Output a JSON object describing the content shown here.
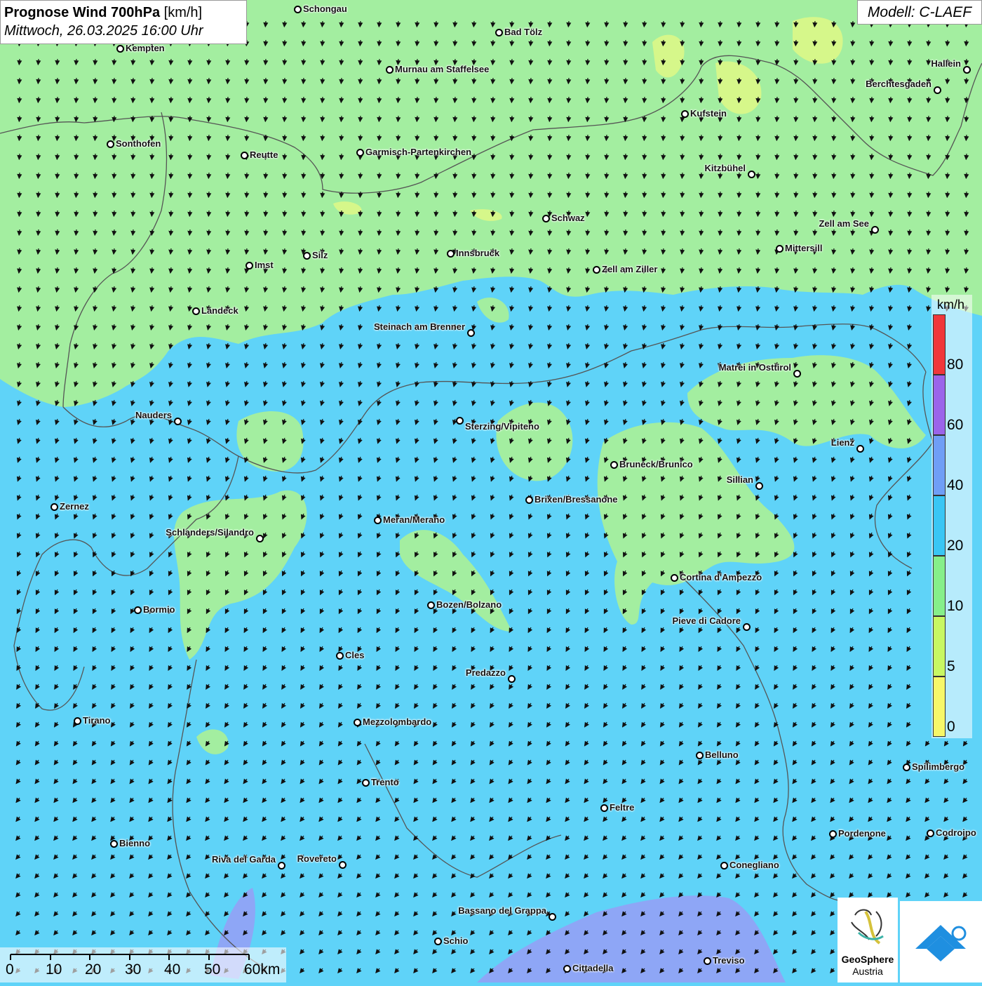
{
  "title": {
    "main": "Prognose Wind 700hPa",
    "unit": "[km/h]",
    "datetime": "Mittwoch, 26.03.2025 16:00 Uhr"
  },
  "model": "Modell: C-LAEF",
  "colors": {
    "green_zone": "#a3eea0",
    "blue_zone": "#5fd3f8",
    "violet_zone": "#8ea6f6",
    "yellow_zone": "#e6f98a",
    "arrow": "#111111",
    "border": "#555555"
  },
  "legend": {
    "unit": "km/h",
    "labels": [
      "80",
      "60",
      "40",
      "20",
      "10",
      "5",
      "0"
    ],
    "stops": [
      {
        "from": 80,
        "color": "#f0373a"
      },
      {
        "from": 60,
        "color": "#9b64ea"
      },
      {
        "from": 40,
        "color": "#6f9ef6"
      },
      {
        "from": 20,
        "color": "#39c6f4"
      },
      {
        "from": 10,
        "color": "#86ef8a"
      },
      {
        "from": 5,
        "color": "#c8f762"
      },
      {
        "from": 0,
        "color": "#f7f769"
      }
    ]
  },
  "scalebar": {
    "labels": [
      "0",
      "10",
      "20",
      "30",
      "40",
      "50",
      "60km"
    ]
  },
  "cities": [
    {
      "name": "Schongau",
      "label_side": "right"
    },
    {
      "name": "Bad Tölz",
      "label_side": "right"
    },
    {
      "name": "Kempten",
      "label_side": "right"
    },
    {
      "name": "Hallein",
      "label_side": "left"
    },
    {
      "name": "Murnau am Staffelsee",
      "label_side": "right"
    },
    {
      "name": "Berchtesgaden",
      "label_side": "left"
    },
    {
      "name": "Kufstein",
      "label_side": "right"
    },
    {
      "name": "Sonthofen",
      "label_side": "right"
    },
    {
      "name": "Reutte",
      "label_side": "right"
    },
    {
      "name": "Garmisch-Partenkirchen",
      "label_side": "right"
    },
    {
      "name": "Kitzbühel",
      "label_side": "left"
    },
    {
      "name": "Schwaz",
      "label_side": "right"
    },
    {
      "name": "Zell am See",
      "label_side": "left"
    },
    {
      "name": "Mittersill",
      "label_side": "right"
    },
    {
      "name": "Innsbruck",
      "label_side": "right"
    },
    {
      "name": "Silz",
      "label_side": "right"
    },
    {
      "name": "Imst",
      "label_side": "right"
    },
    {
      "name": "Zell am Ziller",
      "label_side": "right"
    },
    {
      "name": "Landeck",
      "label_side": "right"
    },
    {
      "name": "Steinach am Brenner",
      "label_side": "left"
    },
    {
      "name": "Matrei in Osttirol",
      "label_side": "left"
    },
    {
      "name": "Nauders",
      "label_side": "left"
    },
    {
      "name": "Sterzing/Vipiteno",
      "label_side": "below"
    },
    {
      "name": "Lienz",
      "label_side": "left"
    },
    {
      "name": "Bruneck/Brunico",
      "label_side": "right"
    },
    {
      "name": "Sillian",
      "label_side": "left"
    },
    {
      "name": "Brixen/Bressanone",
      "label_side": "right"
    },
    {
      "name": "Zernez",
      "label_side": "right"
    },
    {
      "name": "Meran/Merano",
      "label_side": "right"
    },
    {
      "name": "Schlanders/Silandro",
      "label_side": "left"
    },
    {
      "name": "Cortina d'Ampezzo",
      "label_side": "right"
    },
    {
      "name": "Bozen/Bolzano",
      "label_side": "right"
    },
    {
      "name": "Bormio",
      "label_side": "right"
    },
    {
      "name": "Pieve di Cadore",
      "label_side": "left"
    },
    {
      "name": "Cles",
      "label_side": "right"
    },
    {
      "name": "Predazzo",
      "label_side": "left"
    },
    {
      "name": "Tirano",
      "label_side": "right"
    },
    {
      "name": "Mezzolombardo",
      "label_side": "right"
    },
    {
      "name": "Belluno",
      "label_side": "right"
    },
    {
      "name": "Spilimbergo",
      "label_side": "right"
    },
    {
      "name": "Trento",
      "label_side": "right"
    },
    {
      "name": "Feltre",
      "label_side": "right"
    },
    {
      "name": "Pordenone",
      "label_side": "right"
    },
    {
      "name": "Codroipo",
      "label_side": "right"
    },
    {
      "name": "Bienno",
      "label_side": "right"
    },
    {
      "name": "Riva del Garda",
      "label_side": "left"
    },
    {
      "name": "Rovereto",
      "label_side": "left"
    },
    {
      "name": "Conegliano",
      "label_side": "right"
    },
    {
      "name": "Bassano del Grappa",
      "label_side": "left"
    },
    {
      "name": "Schio",
      "label_side": "right"
    },
    {
      "name": "Treviso",
      "label_side": "right"
    },
    {
      "name": "Cittadella",
      "label_side": "right"
    }
  ],
  "logos": {
    "geosphere": [
      "GeoSphere",
      "Austria"
    ]
  }
}
